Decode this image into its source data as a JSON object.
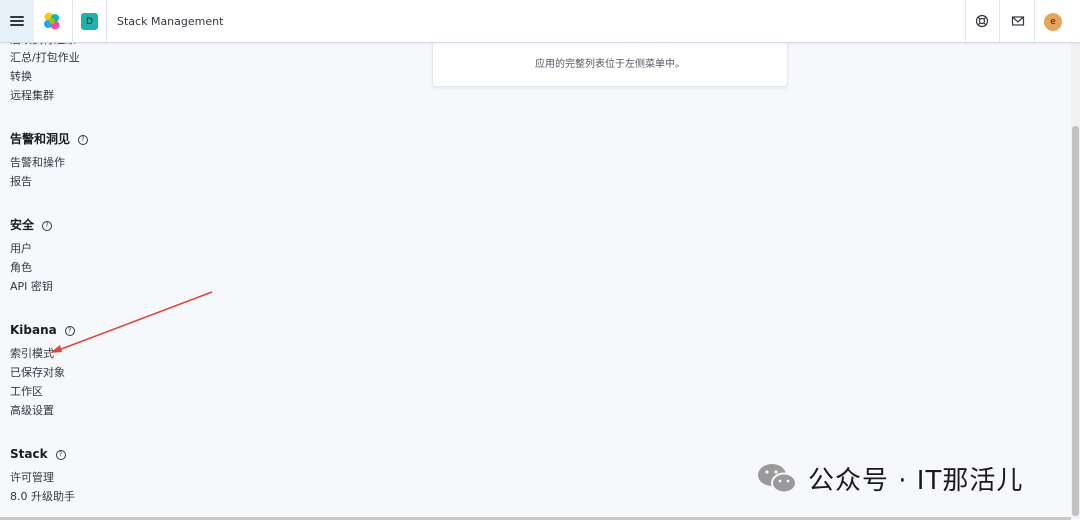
{
  "header": {
    "space_initial": "D",
    "title": "Stack Management",
    "user_initial": "e",
    "icons": [
      "menu-icon",
      "elastic-logo",
      "help-icon",
      "mail-icon"
    ]
  },
  "sidebar": {
    "top_items": [
      "后续执行还原",
      "汇总/打包作业",
      "转换",
      "远程集群"
    ],
    "groups": [
      {
        "title": "告警和洞见",
        "items": [
          "告警和操作",
          "报告"
        ]
      },
      {
        "title": "安全",
        "items": [
          "用户",
          "角色",
          "API 密钥"
        ]
      },
      {
        "title": "Kibana",
        "items": [
          "索引模式",
          "已保存对象",
          "工作区",
          "高级设置"
        ]
      },
      {
        "title": "Stack",
        "items": [
          "许可管理",
          "8.0 升级助手"
        ]
      }
    ]
  },
  "main": {
    "panel_text": "应用的完整列表位于左侧菜单中。"
  },
  "watermark": {
    "text": "公众号 · IT那活儿"
  },
  "colors": {
    "accent_teal": "#20b2aa",
    "avatar": "#e7a55b",
    "arrow": "#e0443a",
    "background": "#f7f8fc"
  }
}
